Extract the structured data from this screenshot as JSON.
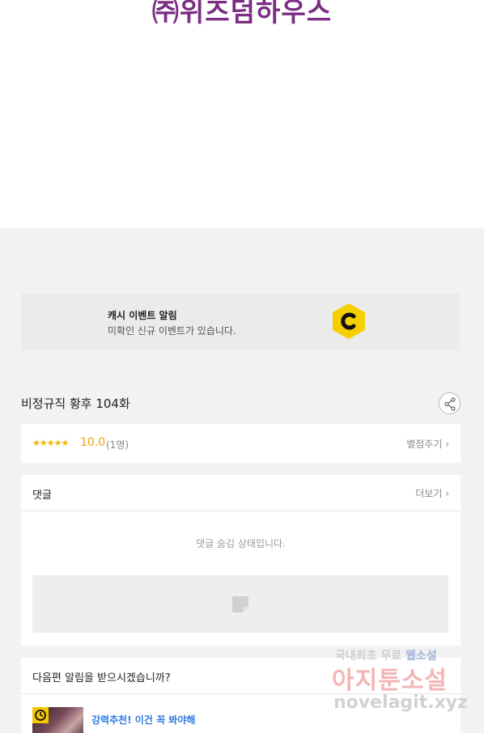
{
  "publisher": {
    "logo_text": "㈜위즈덤하우스"
  },
  "event_banner": {
    "title": "캐시 이벤트 알림",
    "subtitle": "미확인 신규 이벤트가 있습니다.",
    "icon": "cash-c-icon",
    "icon_color": "#f5d000"
  },
  "episode": {
    "title": "비정규직 황후 104화",
    "share_icon": "share-icon"
  },
  "rating": {
    "stars": "★★★★★",
    "score": "10.0",
    "count": "(1명)",
    "rate_link": "별점주기 ›"
  },
  "comments": {
    "title": "댓글",
    "more_link": "더보기 ›",
    "hidden_notice": "댓글 숨김 상태입니다."
  },
  "notify": {
    "title": "다음편 알림을 받으시겠습니까?",
    "recommend_tag": "강력추천! 이건 꼭 봐야해",
    "recommend_title": "..."
  },
  "watermark": {
    "line1_prefix": "국내최초 무료",
    "line1_highlight": "웹소설",
    "line2": "아지툰소설",
    "line3": "novelagit.xyz"
  },
  "colors": {
    "accent_blue": "#2a7be4",
    "star": "#f5b400",
    "logo_purple": "#7a2d82"
  }
}
